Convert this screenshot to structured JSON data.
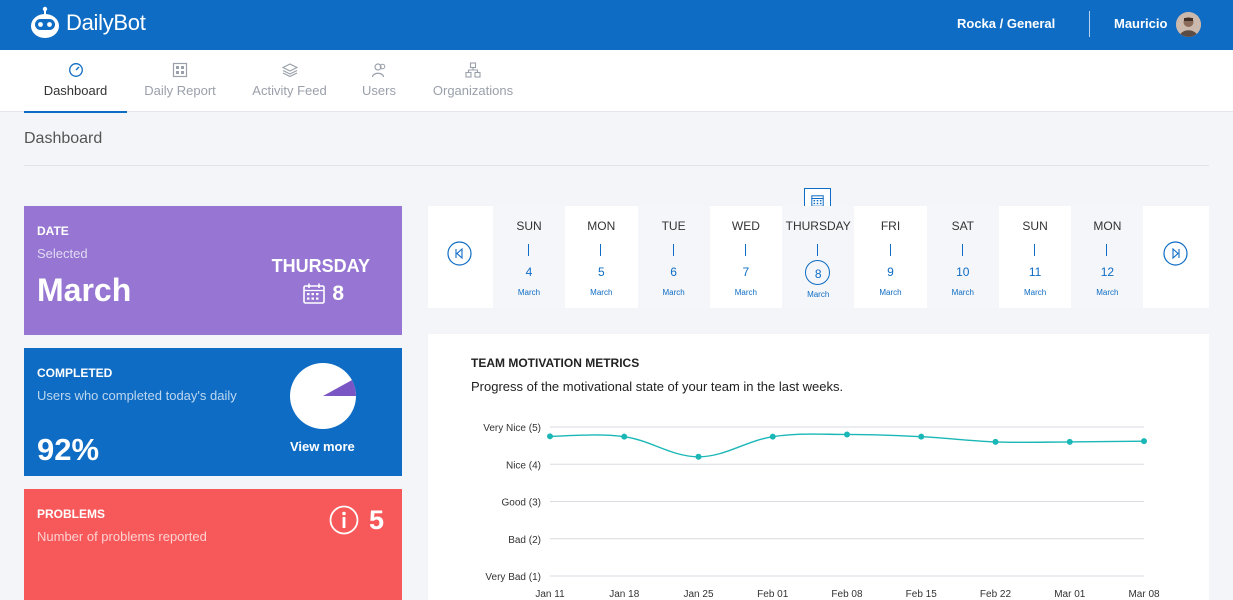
{
  "header": {
    "brand": "DailyBot",
    "team": "Rocka / General",
    "user": "Mauricio"
  },
  "nav": {
    "tabs": [
      {
        "label": "Dashboard",
        "icon": "speedometer-icon",
        "active": true
      },
      {
        "label": "Daily Report",
        "icon": "report-grid-icon",
        "active": false
      },
      {
        "label": "Activity Feed",
        "icon": "layers-icon",
        "active": false
      },
      {
        "label": "Users",
        "icon": "users-icon",
        "active": false
      },
      {
        "label": "Organizations",
        "icon": "org-chart-icon",
        "active": false
      }
    ]
  },
  "page": {
    "title": "Dashboard"
  },
  "date_card": {
    "title": "DATE",
    "subtitle": "Selected",
    "month": "March",
    "weekday": "THURSDAY",
    "day": "8",
    "color": "#9676d2"
  },
  "completed_card": {
    "title": "COMPLETED",
    "subtitle": "Users who completed today's daily",
    "percent": "92%",
    "completed_fraction": 0.92,
    "link": "View more",
    "color": "#0e6cc4"
  },
  "problems_card": {
    "title": "PROBLEMS",
    "subtitle": "Number of problems reported",
    "count": "5",
    "color": "#f7595a"
  },
  "date_picker": {
    "days": [
      {
        "name": "SUN",
        "num": "4",
        "month": "March"
      },
      {
        "name": "MON",
        "num": "5",
        "month": "March"
      },
      {
        "name": "TUE",
        "num": "6",
        "month": "March"
      },
      {
        "name": "WED",
        "num": "7",
        "month": "March"
      },
      {
        "name": "THURSDAY",
        "num": "8",
        "month": "March",
        "selected": true
      },
      {
        "name": "FRI",
        "num": "9",
        "month": "March"
      },
      {
        "name": "SAT",
        "num": "10",
        "month": "March"
      },
      {
        "name": "SUN",
        "num": "11",
        "month": "March"
      },
      {
        "name": "MON",
        "num": "12",
        "month": "March"
      }
    ]
  },
  "metrics": {
    "title": "TEAM MOTIVATION METRICS",
    "subtitle": "Progress of the motivational state of your team in the last weeks."
  },
  "chart_data": {
    "type": "line",
    "x": [
      "Jan 11",
      "Jan 18",
      "Jan 25",
      "Feb 01",
      "Feb 08",
      "Feb 15",
      "Feb 22",
      "Mar 01",
      "Mar 08"
    ],
    "series": [
      {
        "values": [
          4.75,
          4.74,
          4.2,
          4.74,
          4.8,
          4.74,
          4.6,
          4.6,
          4.62
        ]
      }
    ],
    "y_tick_labels": [
      "Very Bad (1)",
      "Bad (2)",
      "Good (3)",
      "Nice (4)",
      "Very Nice (5)"
    ],
    "ylim": [
      1,
      5
    ],
    "grid": true,
    "color": "#1bb7b7"
  }
}
